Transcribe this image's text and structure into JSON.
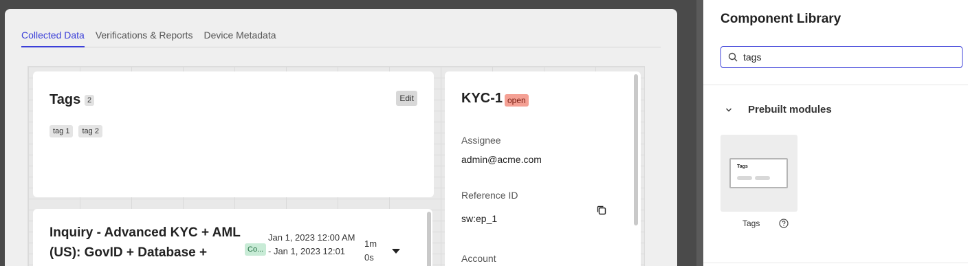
{
  "tabs": [
    {
      "label": "Collected Data",
      "active": true
    },
    {
      "label": "Verifications & Reports",
      "active": false
    },
    {
      "label": "Device Metadata",
      "active": false
    }
  ],
  "tags_card": {
    "title": "Tags",
    "count": "2",
    "edit_label": "Edit",
    "tags": [
      "tag 1",
      "tag 2"
    ]
  },
  "inquiry_card": {
    "title": "Inquiry - Advanced KYC + AML (US): GovID + Database +",
    "status": "Co...",
    "date_line1": "Jan 1, 2023 12:00 AM",
    "date_line2": "- Jan 1, 2023 12:01",
    "duration_line1": "1m",
    "duration_line2": "0s"
  },
  "kyc_card": {
    "title": "KYC-1",
    "status": "open",
    "assignee_label": "Assignee",
    "assignee_value": "admin@acme.com",
    "reference_label": "Reference ID",
    "reference_value": "sw:ep_1",
    "account_label": "Account"
  },
  "panel": {
    "title": "Component Library",
    "search_value": "tags",
    "section_title": "Prebuilt modules",
    "module": {
      "thumb_title": "Tags",
      "label": "Tags"
    }
  },
  "colors": {
    "accent": "#3b3fd8",
    "open_badge": "#f4a094",
    "status_green": "#c8ebd6"
  }
}
